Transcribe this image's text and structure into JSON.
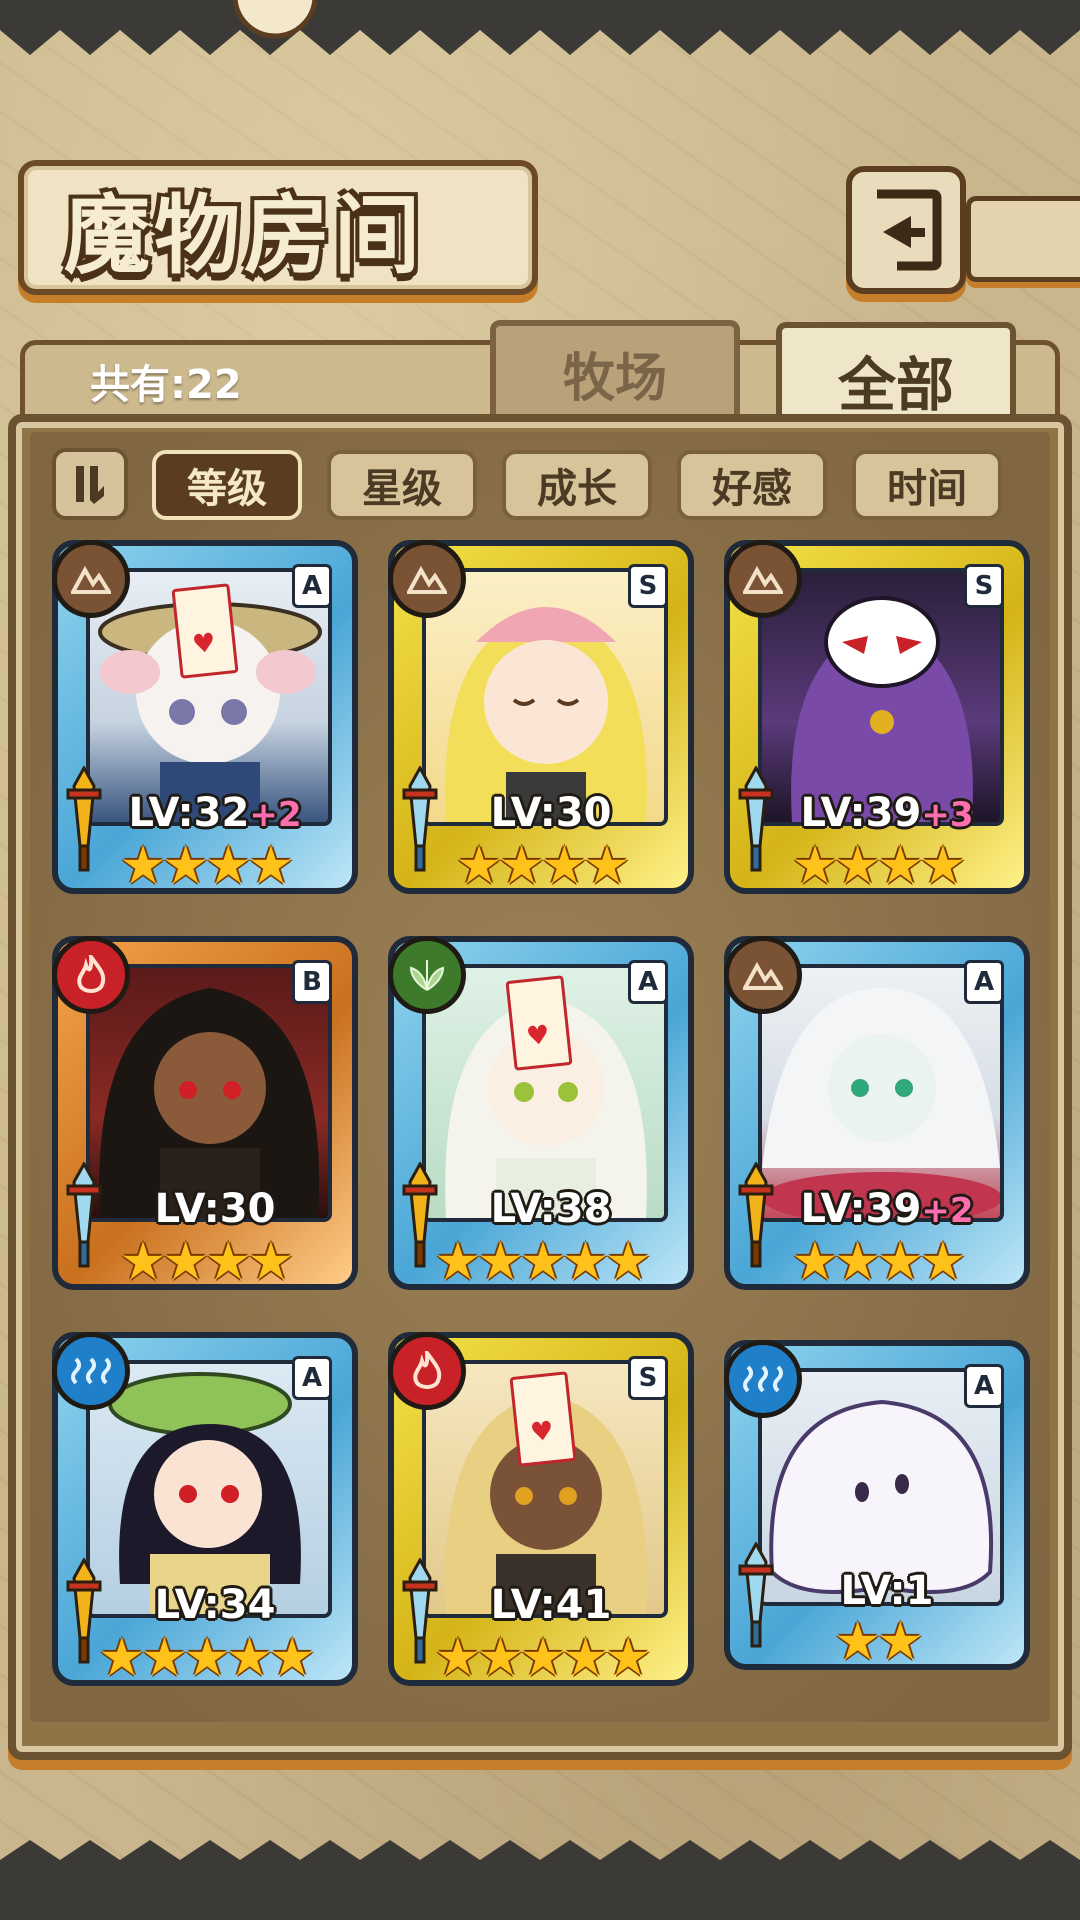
{
  "title": "魔物房间",
  "count_label": "共有:22",
  "tabs": [
    {
      "label": "牧场",
      "active": false
    },
    {
      "label": "全部",
      "active": true
    }
  ],
  "sort_toggle_icon": "pause-bars-icon",
  "sort_options": [
    {
      "label": "等级",
      "active": true
    },
    {
      "label": "星级",
      "active": false
    },
    {
      "label": "成长",
      "active": false
    },
    {
      "label": "好感",
      "active": false
    },
    {
      "label": "时间",
      "active": false
    }
  ],
  "colors": {
    "card_blue": "#4aa6d6",
    "card_gold": "#d4b417",
    "card_bronze": "#c9701e",
    "plus_level": "#ff6fb0",
    "star": "#ffc21a"
  },
  "monsters": [
    {
      "lv": "LV:32",
      "plus": "+2",
      "rank": "A",
      "element": "earth",
      "stars": "★★★★",
      "frame": "blue"
    },
    {
      "lv": "LV:30",
      "plus": "",
      "rank": "S",
      "element": "earth",
      "stars": "★★★★",
      "frame": "gold"
    },
    {
      "lv": "LV:39",
      "plus": "+3",
      "rank": "S",
      "element": "earth",
      "stars": "★★★★",
      "frame": "gold"
    },
    {
      "lv": "LV:30",
      "plus": "",
      "rank": "B",
      "element": "fire",
      "stars": "★★★★",
      "frame": "bronze"
    },
    {
      "lv": "LV:38",
      "plus": "",
      "rank": "A",
      "element": "wood",
      "stars": "★★★★★",
      "frame": "blue"
    },
    {
      "lv": "LV:39",
      "plus": "+2",
      "rank": "A",
      "element": "earth",
      "stars": "★★★★",
      "frame": "blue"
    },
    {
      "lv": "LV:34",
      "plus": "",
      "rank": "A",
      "element": "water",
      "stars": "★★★★★",
      "frame": "blue"
    },
    {
      "lv": "LV:41",
      "plus": "",
      "rank": "S",
      "element": "fire",
      "stars": "★★★★★",
      "frame": "gold"
    },
    {
      "lv": "LV:1",
      "plus": "",
      "rank": "A",
      "element": "water",
      "stars": "★★",
      "frame": "blue"
    }
  ]
}
